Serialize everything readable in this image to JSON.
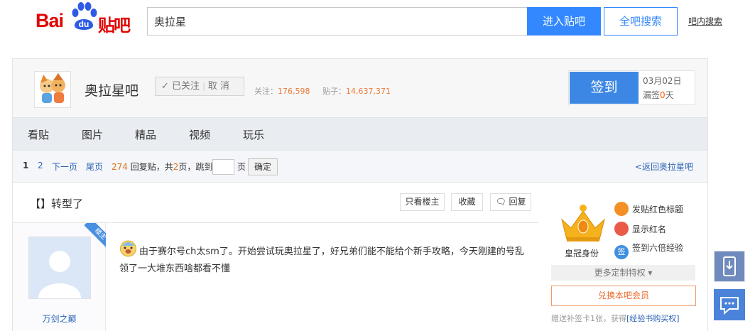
{
  "header": {
    "logo_bai": "Bai",
    "logo_du": "du",
    "logo_tieba": "贴吧",
    "search_value": "奥拉星",
    "enter_button": "进入贴吧",
    "all_search_button": "全吧搜索",
    "in_bar_search": "吧内搜索"
  },
  "forum": {
    "name": "奥拉星吧",
    "follow_label": "已关注",
    "unfollow_label": "取 消",
    "followers_label": "关注：",
    "followers": "176,598",
    "posts_label": "贴子：",
    "posts": "14,637,371",
    "sign_button": "签到",
    "date": "03月02日",
    "miss_prefix": "漏签",
    "miss_count": "0",
    "miss_suffix": "天"
  },
  "nav": [
    "看贴",
    "图片",
    "精品",
    "视频",
    "玩乐"
  ],
  "pager": {
    "current": "1",
    "page2": "2",
    "next": "下一页",
    "last": "尾页",
    "reply_count": "274",
    "reply_text": "回复贴，共",
    "total_pages": "2",
    "pages_text": "页，跳到",
    "page_unit": "页",
    "confirm": "确定",
    "back": "<返回奥拉星吧"
  },
  "thread": {
    "title": "【】转型了",
    "only_op": "只看楼主",
    "favorite": "收藏",
    "reply": "回复",
    "op_badge": "楼主",
    "username": "万剑之巅",
    "content": "由于赛尔号ch太sm了。开始尝试玩奥拉星了，好兄弟们能不能给个新手攻略，今天刚建的号乱领了一大堆东西啥都看不懂"
  },
  "sidebar": {
    "crown_label": "皇冠身份",
    "perks": [
      "发贴红色标题",
      "显示红名",
      "签到六倍经验"
    ],
    "perk_icons": [
      "bookmark-icon",
      "chat-icon",
      "sign-icon"
    ],
    "perk_icon_glyphs": [
      "",
      "",
      "签"
    ],
    "more": "更多定制特权",
    "vip_button": "兑换本吧会员",
    "gift_text": "赠送补签卡1张，获得",
    "gift_link": "[经验书购买权]"
  },
  "colors": {
    "accent": "#3388ff",
    "brand_red": "#e10602",
    "orange": "#ee7a38"
  }
}
